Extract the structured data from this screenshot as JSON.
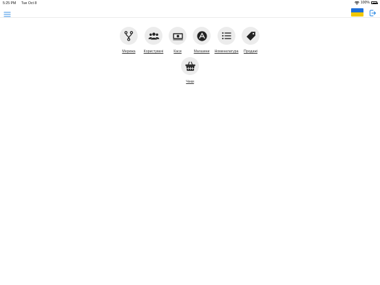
{
  "status_bar": {
    "time": "5:25 PM",
    "date": "Tue Oct 8",
    "battery": "100%"
  },
  "nav": {
    "menu_icon": "hamburger-menu-icon",
    "flag_colors": [
      "#1e6fd9",
      "#f2c800"
    ],
    "logout_icon": "logout-icon",
    "accent_color": "#1a7fe0"
  },
  "tiles": [
    {
      "label": "Мережа",
      "icon": "branch-icon"
    },
    {
      "label": "Користувачі",
      "icon": "users-icon"
    },
    {
      "label": "Каси",
      "icon": "cash-register-icon"
    },
    {
      "label": "Магазини",
      "icon": "app-store-icon"
    },
    {
      "label": "Номенклатура",
      "icon": "list-icon"
    },
    {
      "label": "Продажі",
      "icon": "tag-icon"
    },
    {
      "label": "Чеки",
      "icon": "basket-icon"
    }
  ]
}
